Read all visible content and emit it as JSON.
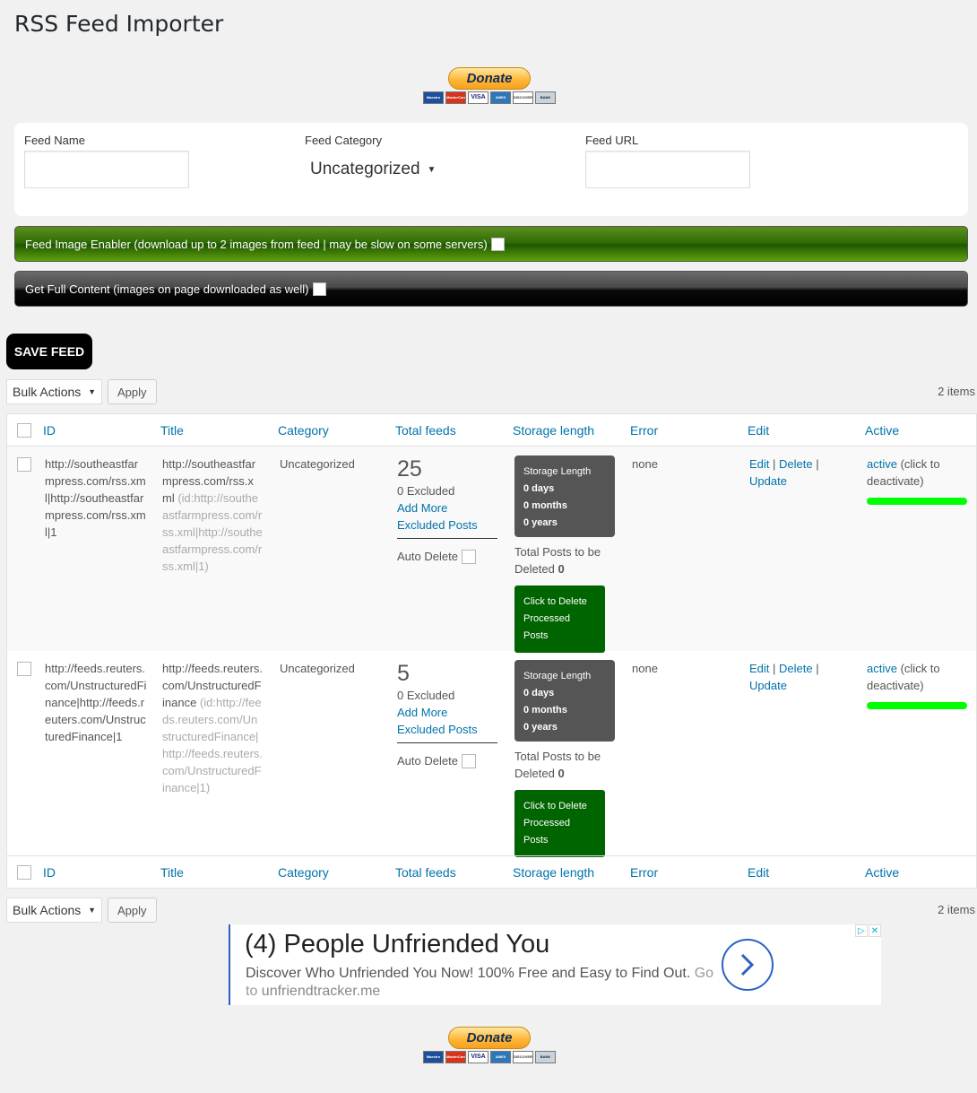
{
  "page": {
    "title": "RSS Feed Importer"
  },
  "donate": {
    "button_label": "Donate",
    "cards": [
      "Maestro",
      "MasterCard",
      "VISA",
      "AMEX",
      "DISCOVER",
      "BANK"
    ]
  },
  "form": {
    "feed_name_label": "Feed Name",
    "feed_name_value": "",
    "feed_category_label": "Feed Category",
    "feed_category_value": "Uncategorized",
    "feed_url_label": "Feed URL",
    "feed_url_value": "",
    "image_enabler_label": "Feed Image Enabler (download up to 2 images from feed | may be slow on some servers)",
    "full_content_label": "Get Full Content (images on page downloaded as well)",
    "save_button": "SAVE FEED"
  },
  "bulk": {
    "selected": "Bulk Actions",
    "apply": "Apply",
    "items_count": "2 items"
  },
  "table": {
    "columns": [
      "ID",
      "Title",
      "Category",
      "Total feeds",
      "Storage length",
      "Error",
      "Edit",
      "Active"
    ],
    "rows": [
      {
        "id": "http://southeastfarmpress.com/rss.xml|http://southeastfarmpress.com/rss.xml|1",
        "title": "http://southeastfarmpress.com/rss.xml",
        "title_id": "(id:http://southeastfarmpress.com/rss.xml|http://southeastfarmpress.com/rss.xml|1)",
        "category": "Uncategorized",
        "total": "25",
        "excluded": "0 Excluded",
        "add_more": "Add More Excluded Posts",
        "auto_delete": "Auto Delete",
        "storage": {
          "title": "Storage Length",
          "days": "0 days",
          "months": "0 months",
          "years": "0 years"
        },
        "total_posts_label": "Total Posts to be Deleted",
        "total_posts_value": "0",
        "delete_btn": "Click to Delete Processed Posts",
        "error": "none",
        "edit": "Edit",
        "delete": "Delete",
        "update": "Update",
        "sep": "|",
        "active": "active",
        "active_note": "(click to deactivate)"
      },
      {
        "id": "http://feeds.reuters.com/UnstructuredFinance|http://feeds.reuters.com/UnstructuredFinance|1",
        "title": "http://feeds.reuters.com/UnstructuredFinance",
        "title_id": "(id:http://feeds.reuters.com/UnstructuredFinance|http://feeds.reuters.com/UnstructuredFinance|1)",
        "category": "Uncategorized",
        "total": "5",
        "excluded": "0 Excluded",
        "add_more": "Add More Excluded Posts",
        "auto_delete": "Auto Delete",
        "storage": {
          "title": "Storage Length",
          "days": "0 days",
          "months": "0 months",
          "years": "0 years"
        },
        "total_posts_label": "Total Posts to be Deleted",
        "total_posts_value": "0",
        "delete_btn": "Click to Delete Processed Posts",
        "error": "none",
        "edit": "Edit",
        "delete": "Delete",
        "update": "Update",
        "sep": "|",
        "active": "active",
        "active_note": "(click to deactivate)"
      }
    ]
  },
  "ad": {
    "title": "(4) People Unfriended You",
    "desc": "Discover Who Unfriended You Now! 100% Free and Easy to Find Out.",
    "go": "Go to",
    "url": "unfriendtracker.me"
  },
  "colors": {
    "active_bar": "#00ff00",
    "delete_btn": "#006400",
    "storage_box": "#555555",
    "link": "#0073aa"
  }
}
